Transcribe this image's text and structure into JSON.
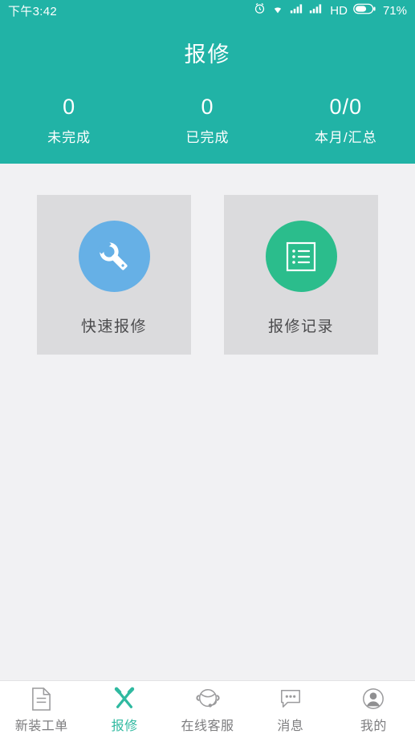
{
  "theme": {
    "header_teal": "#21b3a6",
    "body_gray": "#f1f1f3",
    "card_gray": "#dbdbdd",
    "icon_blue": "#66b0e6",
    "icon_green": "#2bbd8c",
    "active_tab": "#2fb9a0",
    "inactive_tab": "#7d7d7f"
  },
  "status_bar": {
    "time": "下午3:42",
    "battery_percent": "71%",
    "network_label": "HD",
    "icons": [
      "alarm-icon",
      "wifi-icon",
      "signal-bars-icon",
      "signal-bars-icon",
      "hd-icon",
      "battery-icon"
    ]
  },
  "header": {
    "title": "报修",
    "stats": [
      {
        "value": "0",
        "label": "未完成"
      },
      {
        "value": "0",
        "label": "已完成"
      },
      {
        "value": "0/0",
        "label": "本月/汇总"
      }
    ]
  },
  "main": {
    "cards": [
      {
        "label": "快速报修",
        "icon": "wrench-icon",
        "color": "#66b0e6"
      },
      {
        "label": "报修记录",
        "icon": "list-doc-icon",
        "color": "#2bbd8c"
      }
    ]
  },
  "tabbar": {
    "items": [
      {
        "label": "新装工单",
        "icon": "document-icon",
        "active": false
      },
      {
        "label": "报修",
        "icon": "tools-icon",
        "active": true
      },
      {
        "label": "在线客服",
        "icon": "headset-icon",
        "active": false
      },
      {
        "label": "消息",
        "icon": "chat-icon",
        "active": false
      },
      {
        "label": "我的",
        "icon": "person-icon",
        "active": false
      }
    ]
  }
}
